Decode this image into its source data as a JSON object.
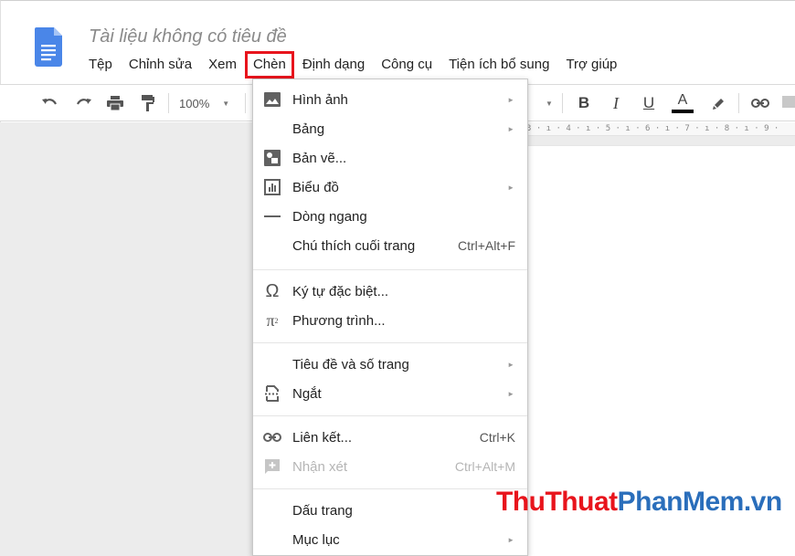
{
  "document": {
    "title": "Tài liệu không có tiêu đề"
  },
  "menubar": {
    "items": [
      "Tệp",
      "Chỉnh sửa",
      "Xem",
      "Chèn",
      "Định dạng",
      "Công cụ",
      "Tiện ích bổ sung",
      "Trợ giúp"
    ],
    "active": "Chèn",
    "highlight_color": "#e8141c"
  },
  "toolbar": {
    "zoom": "100%",
    "bold": "B",
    "italic": "I",
    "underline": "U",
    "text_color": "A"
  },
  "ruler": {
    "text": "3 · ı · 4 · ı · 5 · ı · 6 · ı · 7 · ı · 8 · ı · 9 ·"
  },
  "insert_menu": {
    "groups": [
      [
        {
          "label": "Hình ảnh",
          "icon": "image-icon",
          "submenu": true
        },
        {
          "label": "Bảng",
          "icon": "",
          "submenu": true
        },
        {
          "label": "Bản vẽ...",
          "icon": "drawing-icon",
          "submenu": false
        },
        {
          "label": "Biểu đồ",
          "icon": "chart-icon",
          "submenu": true
        },
        {
          "label": "Dòng ngang",
          "icon": "horizontal-line-icon",
          "submenu": false
        },
        {
          "label": "Chú thích cuối trang",
          "icon": "",
          "shortcut": "Ctrl+Alt+F"
        }
      ],
      [
        {
          "label": "Ký tự đặc biệt...",
          "icon": "omega-icon",
          "submenu": false
        },
        {
          "label": "Phương trình...",
          "icon": "pi-icon",
          "submenu": false
        }
      ],
      [
        {
          "label": "Tiêu đề và số trang",
          "icon": "",
          "submenu": true
        },
        {
          "label": "Ngắt",
          "icon": "page-break-icon",
          "submenu": true
        }
      ],
      [
        {
          "label": "Liên kết...",
          "icon": "link-icon",
          "shortcut": "Ctrl+K"
        },
        {
          "label": "Nhận xét",
          "icon": "comment-icon",
          "shortcut": "Ctrl+Alt+M",
          "disabled": true
        }
      ],
      [
        {
          "label": "Dấu trang",
          "icon": "",
          "submenu": false
        },
        {
          "label": "Mục lục",
          "icon": "",
          "submenu": true
        }
      ]
    ]
  },
  "watermark": {
    "part1": "ThuThuat",
    "part2": "PhanMem",
    "part3": ".vn",
    "color1": "#e8141c",
    "color2": "#2a6ebb"
  }
}
